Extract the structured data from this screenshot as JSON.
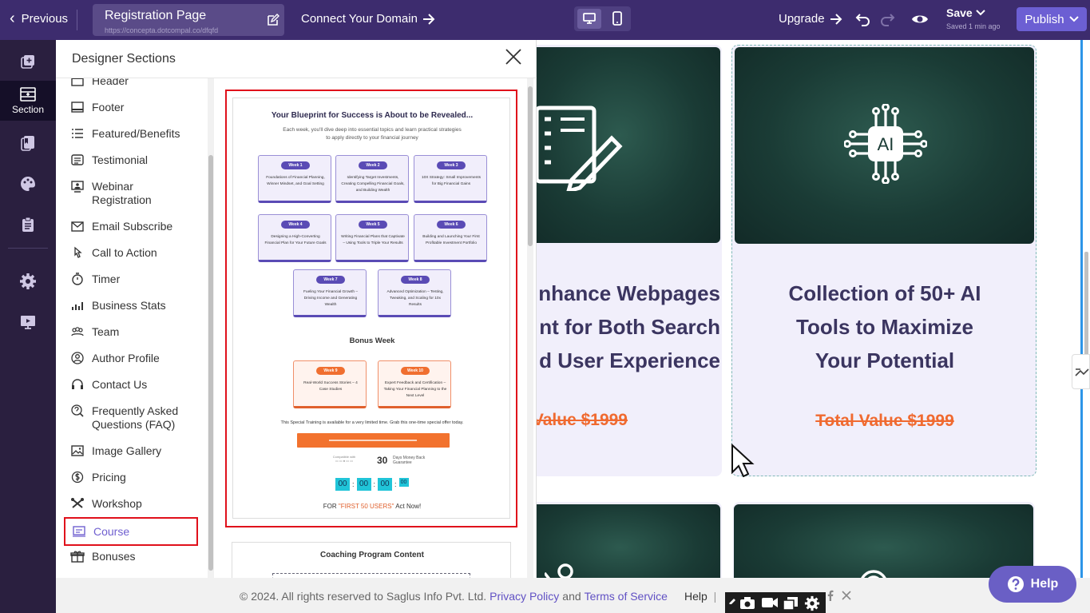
{
  "topbar": {
    "previous_label": "Previous",
    "page_title": "Registration Page",
    "page_url": "https://concepta.dotcompal.co/dfqfd",
    "connect_domain_label": "Connect Your Domain",
    "upgrade_label": "Upgrade",
    "save_label": "Save",
    "saved_status": "Saved 1 min ago",
    "publish_label": "Publish"
  },
  "rail": {
    "items": [
      {
        "label": "",
        "icon": "add-page-icon"
      },
      {
        "label": "Section",
        "icon": "section-icon"
      },
      {
        "label": "",
        "icon": "bookmark-icon"
      },
      {
        "label": "",
        "icon": "palette-icon"
      },
      {
        "label": "",
        "icon": "clipboard-icon"
      },
      {
        "label": "",
        "icon": "gear-icon"
      },
      {
        "label": "",
        "icon": "monitor-icon"
      }
    ]
  },
  "panel": {
    "title": "Designer Sections",
    "items": [
      {
        "label": "Header",
        "icon": "header-icon"
      },
      {
        "label": "Footer",
        "icon": "footer-icon"
      },
      {
        "label": "Featured/Benefits",
        "icon": "list-icon"
      },
      {
        "label": "Testimonial",
        "icon": "testimonial-icon"
      },
      {
        "label": "Webinar Registration",
        "icon": "webinar-icon"
      },
      {
        "label": "Email Subscribe",
        "icon": "email-icon"
      },
      {
        "label": "Call to Action",
        "icon": "click-icon"
      },
      {
        "label": "Timer",
        "icon": "timer-icon"
      },
      {
        "label": "Business Stats",
        "icon": "stats-icon"
      },
      {
        "label": "Team",
        "icon": "team-icon"
      },
      {
        "label": "Author Profile",
        "icon": "user-icon"
      },
      {
        "label": "Contact Us",
        "icon": "headset-icon"
      },
      {
        "label": "Frequently Asked Questions (FAQ)",
        "icon": "faq-icon"
      },
      {
        "label": "Image Gallery",
        "icon": "image-icon"
      },
      {
        "label": "Pricing",
        "icon": "pricing-icon"
      },
      {
        "label": "Workshop",
        "icon": "workshop-icon"
      },
      {
        "label": "Course",
        "icon": "course-icon"
      },
      {
        "label": "Bonuses",
        "icon": "gift-icon"
      }
    ],
    "selected": "Course"
  },
  "preview": {
    "title": "Your Blueprint for Success is About to be Revealed...",
    "subtitle": "Each week, you'll dive deep into essential topics and learn practical strategies to apply directly to your financial journey",
    "weeks": [
      {
        "badge": "Week 1",
        "desc": "Foundations of Financial Planning, Winner Mindset, and Goal Setting"
      },
      {
        "badge": "Week 2",
        "desc": "Identifying Target Investments, Creating Compelling Financial Goals, and Building Wealth"
      },
      {
        "badge": "Week 3",
        "desc": "10X Strategy: Small Improvements for Big Financial Gains"
      },
      {
        "badge": "Week 4",
        "desc": "Designing a High-Converting Financial Plan for Your Future Goals"
      },
      {
        "badge": "Week 5",
        "desc": "Writing Financial Plans that Captivate – Using Tools to Triple Your Results"
      },
      {
        "badge": "Week 6",
        "desc": "Building and Launching Your First Profitable Investment Portfolio"
      },
      {
        "badge": "Week 7",
        "desc": "Fueling Your Financial Growth – Driving Income and Generating Wealth"
      },
      {
        "badge": "Week 8",
        "desc": "Advanced Optimization – Testing, Tweaking, and Scaling for 10x Results"
      }
    ],
    "bonus_title": "Bonus Week",
    "bonus_weeks": [
      {
        "badge": "Week 9",
        "desc": "Real-World Success Stories – 4 Case Studies"
      },
      {
        "badge": "Week 10",
        "desc": "Expert Feedback and Certification – Taking Your Financial Planning to the Next Level"
      }
    ],
    "special_text": "This Special Training is available for a very limited time. Grab this one-time special offer today.",
    "payments_text": "Compatible with",
    "guarantee_number": "30",
    "guarantee_text": "Days Money Back Guarantee",
    "timer": [
      "00",
      "00",
      "00",
      "00"
    ],
    "for_prefix": "FOR",
    "for_highlight": "\"FIRST 50 USERS\"",
    "for_suffix": "Act Now!",
    "next_section_title": "Coaching Program Content"
  },
  "canvas": {
    "card1_title": "nhance Webpages nt for Both Search d User Experience",
    "card1_title_lines": [
      "nhance Webpages",
      "nt for Both Search",
      "d User Experience"
    ],
    "card1_price": "l Value $1999",
    "card2_title_lines": [
      "Collection of 50+ AI",
      "Tools to Maximize",
      "Your Potential"
    ],
    "card2_price": "Total Value $1999",
    "ai_chip_label": "AI"
  },
  "footer": {
    "copyright": "© 2024. All rights reserved to Saglus Info Pvt. Ltd.",
    "privacy": "Privacy Policy",
    "and": "and",
    "terms": "Terms of Service",
    "help": "Help",
    "sep": "|"
  },
  "help_button": "Help",
  "colors": {
    "topbar": "#3d2c6e",
    "rail": "#2a1f3f",
    "accent": "#6c5fd3",
    "highlight": "#e0101b",
    "price": "#f06a30"
  }
}
